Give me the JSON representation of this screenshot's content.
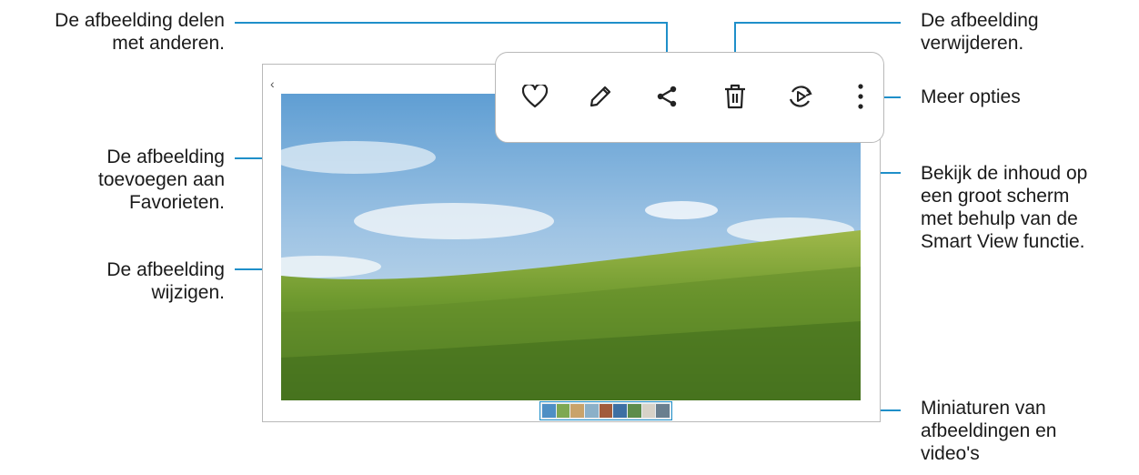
{
  "callouts": {
    "share": [
      "De afbeelding delen",
      "met anderen."
    ],
    "favorite": [
      "De afbeelding",
      "toevoegen aan",
      "Favorieten."
    ],
    "edit": [
      "De afbeelding",
      "wijzigen."
    ],
    "delete": [
      "De afbeelding",
      "verwijderen."
    ],
    "more": [
      "Meer opties"
    ],
    "smartview": [
      "Bekijk de inhoud op",
      "een groot scherm",
      "met behulp van de",
      "Smart View functie."
    ],
    "thumbnails": [
      "Miniaturen van",
      "afbeeldingen en",
      "video's"
    ]
  },
  "toolbar": {
    "icons": [
      "heart-icon",
      "pencil-icon",
      "share-icon",
      "trash-icon",
      "smart-view-icon",
      "more-options-icon"
    ]
  },
  "colors": {
    "callout_line": "#1f8fc9",
    "frame_border": "#b9b9b9"
  }
}
